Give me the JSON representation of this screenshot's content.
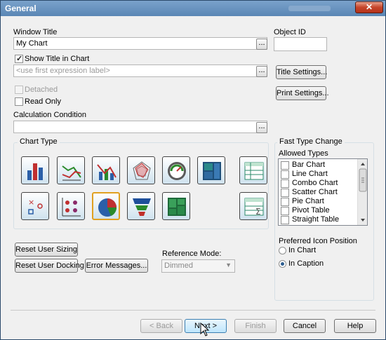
{
  "window": {
    "title": "General",
    "close_glyph": "✕"
  },
  "fields": {
    "window_title_label": "Window Title",
    "window_title_value": "My Chart",
    "object_id_label": "Object ID",
    "object_id_value": "",
    "show_title_label": "Show Title in Chart",
    "title_expr_placeholder": "<use first expression label>",
    "detached_label": "Detached",
    "read_only_label": "Read Only",
    "calc_condition_label": "Calculation Condition",
    "calc_condition_value": "",
    "browse_glyph": "..."
  },
  "buttons": {
    "title_settings": "Title Settings...",
    "print_settings": "Print Settings...",
    "reset_sizing": "Reset User Sizing",
    "reset_docking": "Reset User Docking",
    "error_messages": "Error Messages...",
    "back": "< Back",
    "next": "Next >",
    "finish": "Finish",
    "cancel": "Cancel",
    "help": "Help"
  },
  "chart_type": {
    "group_label": "Chart Type",
    "icons": [
      "bar-chart",
      "line-chart",
      "combo-chart",
      "radar-chart",
      "gauge-chart",
      "block-chart",
      "pivot-table",
      "scatter-chart",
      "grid-chart",
      "pie-chart",
      "funnel-chart",
      "mekko-chart",
      "straight-table"
    ],
    "selected": "pie-chart"
  },
  "fast_type": {
    "group_label": "Fast Type Change",
    "allowed_label": "Allowed Types",
    "items": [
      "Bar Chart",
      "Line Chart",
      "Combo Chart",
      "Scatter Chart",
      "Pie Chart",
      "Pivot Table",
      "Straight Table"
    ],
    "icon_position_label": "Preferred Icon Position",
    "options": [
      "In Chart",
      "In Caption"
    ],
    "selected_option": "In Caption"
  },
  "reference_mode": {
    "label": "Reference Mode:",
    "value": "Dimmed"
  }
}
